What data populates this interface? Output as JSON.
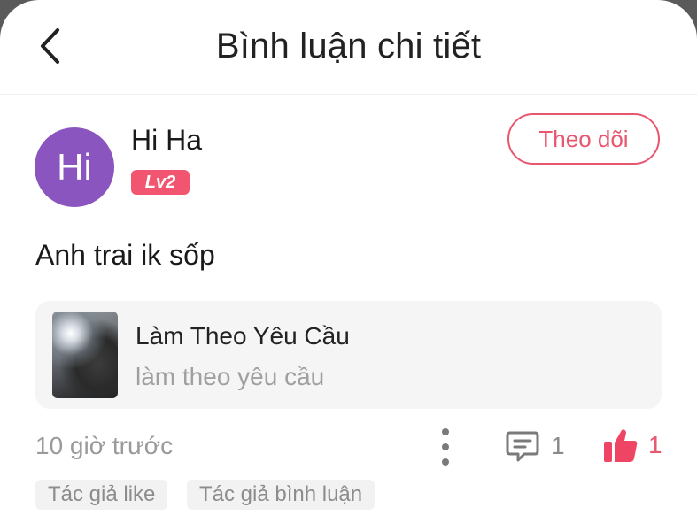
{
  "header": {
    "title": "Bình luận chi tiết",
    "back_icon": "chevron-left-icon"
  },
  "comment": {
    "avatar_text": "Hi",
    "avatar_color": "#8b55bf",
    "username": "Hi Ha",
    "level_badge": "Lv2",
    "follow_label": "Theo dõi",
    "text": "Anh trai ik sốp",
    "time": "10 giờ trước",
    "reply_count": "1",
    "like_count": "1",
    "tags": [
      "Tác giả like",
      "Tác giả bình luận"
    ]
  },
  "reference": {
    "title": "Làm Theo Yêu Cầu",
    "subtitle": "làm theo yêu cầu"
  },
  "colors": {
    "accent": "#e9576f",
    "badge": "#f2556f",
    "muted_text": "#9a9a9a"
  }
}
